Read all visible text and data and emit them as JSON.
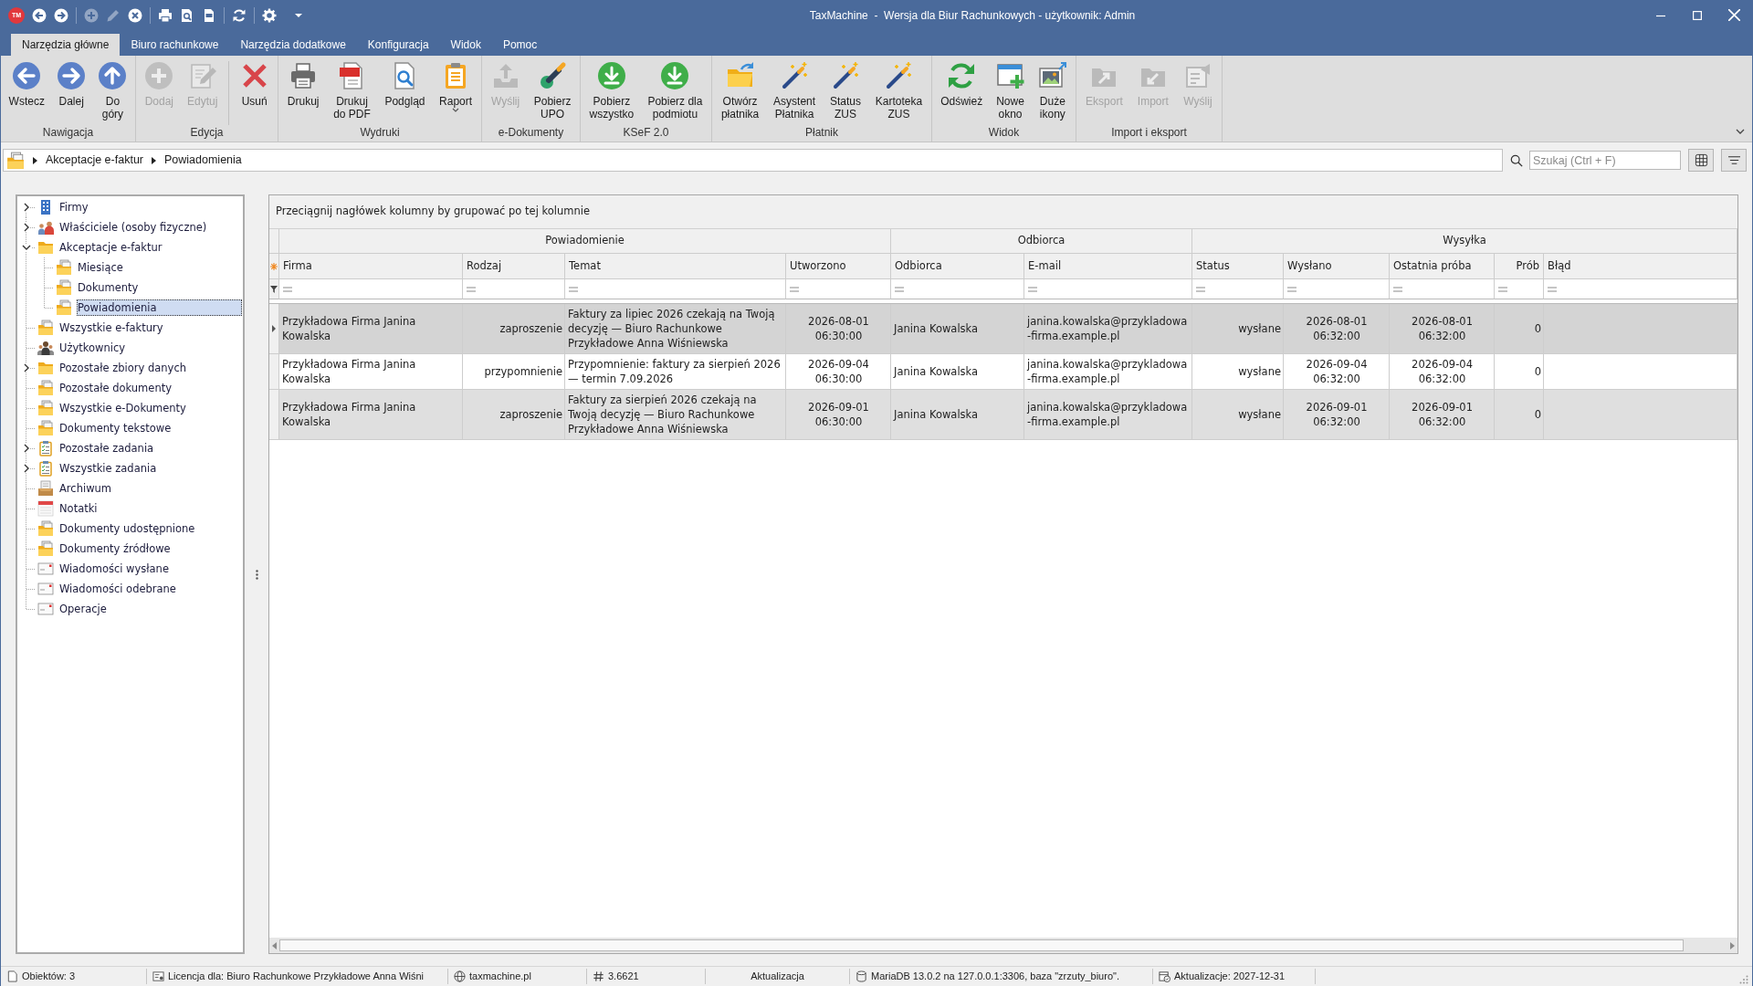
{
  "window": {
    "logo": "TM",
    "title": "TaxMachine  -  Wersja dla Biur Rachunkowych - użytkownik: Admin"
  },
  "quick_access": [
    {
      "kind": "back",
      "disabled": false
    },
    {
      "kind": "forward",
      "disabled": false
    },
    {
      "kind": "separator"
    },
    {
      "kind": "add",
      "disabled": true
    },
    {
      "kind": "edit",
      "disabled": true
    },
    {
      "kind": "delete",
      "disabled": false
    },
    {
      "kind": "separator"
    },
    {
      "kind": "print",
      "disabled": false
    },
    {
      "kind": "preview",
      "disabled": false
    },
    {
      "kind": "pdf",
      "disabled": false
    },
    {
      "kind": "separator"
    },
    {
      "kind": "refresh",
      "disabled": false
    },
    {
      "kind": "separator"
    },
    {
      "kind": "settings",
      "disabled": false
    },
    {
      "kind": "customize"
    }
  ],
  "ribbon": {
    "tabs": [
      {
        "label": "Narzędzia główne",
        "selected": true
      },
      {
        "label": "Biuro rachunkowe",
        "selected": false
      },
      {
        "label": "Narzędzia dodatkowe",
        "selected": false
      },
      {
        "label": "Konfiguracja",
        "selected": false
      },
      {
        "label": "Widok",
        "selected": false
      },
      {
        "label": "Pomoc",
        "selected": false
      }
    ],
    "groups": [
      {
        "label": "Nawigacja",
        "buttons": [
          {
            "label": "Wstecz",
            "kind": "back",
            "disabled": false
          },
          {
            "label": "Dalej",
            "kind": "forward",
            "disabled": false
          },
          {
            "label": "Do\ngóry",
            "kind": "up",
            "disabled": false
          }
        ]
      },
      {
        "label": "Edycja",
        "buttons": [
          {
            "label": "Dodaj",
            "kind": "add",
            "disabled": true
          },
          {
            "label": "Edytuj",
            "kind": "edit",
            "disabled": true
          },
          {
            "label": "Usuń",
            "kind": "delete",
            "disabled": false,
            "separator_before": true
          }
        ]
      },
      {
        "label": "Wydruki",
        "buttons": [
          {
            "label": "Drukuj",
            "kind": "print",
            "disabled": false
          },
          {
            "label": "Drukuj\ndo PDF",
            "kind": "pdf",
            "disabled": false
          },
          {
            "label": "Podgląd",
            "kind": "preview",
            "disabled": false
          },
          {
            "label": "Raport",
            "kind": "report",
            "disabled": false,
            "dropdown": true
          }
        ]
      },
      {
        "label": "e-Dokumenty",
        "buttons": [
          {
            "label": "Wyślij",
            "kind": "send",
            "disabled": true
          },
          {
            "label": "Pobierz\nUPO",
            "kind": "upo",
            "disabled": false
          }
        ]
      },
      {
        "label": "KSeF 2.0",
        "buttons": [
          {
            "label": "Pobierz\nwszystko",
            "kind": "download",
            "disabled": false
          },
          {
            "label": "Pobierz dla\npodmiotu",
            "kind": "download",
            "disabled": false
          }
        ]
      },
      {
        "label": "Płatnik",
        "buttons": [
          {
            "label": "Otwórz\npłatnika",
            "kind": "open-folder",
            "disabled": false
          },
          {
            "label": "Asystent\nPłatnika",
            "kind": "wand",
            "disabled": false
          },
          {
            "label": "Status\nZUS",
            "kind": "wand",
            "disabled": false
          },
          {
            "label": "Kartoteka\nZUS",
            "kind": "wand",
            "disabled": false
          }
        ]
      },
      {
        "label": "Widok",
        "buttons": [
          {
            "label": "Odśwież",
            "kind": "refresh",
            "disabled": false
          },
          {
            "label": "Nowe\nokno",
            "kind": "new-window",
            "disabled": false
          },
          {
            "label": "Duże\nikony",
            "kind": "large-icons",
            "disabled": false
          }
        ]
      },
      {
        "label": "Import i eksport",
        "buttons": [
          {
            "label": "Eksport",
            "kind": "export",
            "disabled": true
          },
          {
            "label": "Import",
            "kind": "import",
            "disabled": true
          },
          {
            "label": "Wyślij",
            "kind": "send-file",
            "disabled": true
          }
        ]
      }
    ]
  },
  "breadcrumb": [
    "Akceptacje e-faktur",
    "Powiadomienia"
  ],
  "search": {
    "placeholder": "Szukaj (Ctrl + F)"
  },
  "sidebar": {
    "items": [
      {
        "label": "Firmy",
        "kind": "building",
        "expanded": false,
        "selected": false
      },
      {
        "label": "Właściciele (osoby fizyczne)",
        "kind": "owners",
        "expanded": false,
        "selected": false
      },
      {
        "label": "Akceptacje e-faktur",
        "kind": "folder",
        "expanded": true,
        "selected": false,
        "children": [
          {
            "label": "Miesiące",
            "kind": "folder-stack",
            "selected": false
          },
          {
            "label": "Dokumenty",
            "kind": "folder-stack",
            "selected": false
          },
          {
            "label": "Powiadomienia",
            "kind": "folder-stack",
            "selected": true
          }
        ]
      },
      {
        "label": "Wszystkie e-faktury",
        "kind": "folder-stack",
        "selected": false
      },
      {
        "label": "Użytkownicy",
        "kind": "users",
        "selected": false
      },
      {
        "label": "Pozostałe zbiory danych",
        "kind": "folder",
        "expanded": false,
        "selected": false
      },
      {
        "label": "Pozostałe dokumenty",
        "kind": "folder-stack",
        "selected": false
      },
      {
        "label": "Wszystkie e-Dokumenty",
        "kind": "folder-stack",
        "selected": false
      },
      {
        "label": "Dokumenty tekstowe",
        "kind": "folder-stack",
        "selected": false
      },
      {
        "label": "Pozostałe zadania",
        "kind": "tasks",
        "expanded": false,
        "selected": false
      },
      {
        "label": "Wszystkie zadania",
        "kind": "tasks",
        "expanded": false,
        "selected": false
      },
      {
        "label": "Archiwum",
        "kind": "archive",
        "selected": false
      },
      {
        "label": "Notatki",
        "kind": "notes",
        "selected": false
      },
      {
        "label": "Dokumenty udostępnione",
        "kind": "folder-stack",
        "selected": false
      },
      {
        "label": "Dokumenty źródłowe",
        "kind": "folder-stack",
        "selected": false
      },
      {
        "label": "Wiadomości wysłane",
        "kind": "message",
        "selected": false
      },
      {
        "label": "Wiadomości odebrane",
        "kind": "message",
        "selected": false
      },
      {
        "label": "Operacje",
        "kind": "message",
        "selected": false
      }
    ]
  },
  "grid": {
    "group_panel_hint": "Przeciągnij nagłówek kolumny by grupować po tej kolumnie",
    "bands": [
      {
        "label": "Powiadomienie",
        "columns": [
          {
            "label": "Firma",
            "kind": "text"
          },
          {
            "label": "Rodzaj",
            "kind": "enum"
          },
          {
            "label": "Temat",
            "kind": "text"
          },
          {
            "label": "Utworzono",
            "kind": "datetime"
          }
        ]
      },
      {
        "label": "Odbiorca",
        "columns": [
          {
            "label": "Odbiorca",
            "kind": "text"
          },
          {
            "label": "E-mail",
            "kind": "email"
          }
        ]
      },
      {
        "label": "Wysyłka",
        "columns": [
          {
            "label": "Status",
            "kind": "enum"
          },
          {
            "label": "Wysłano",
            "kind": "datetime"
          },
          {
            "label": "Ostatnia próba",
            "kind": "datetime"
          },
          {
            "label": "Prób",
            "kind": "count"
          },
          {
            "label": "Błąd",
            "kind": "text"
          }
        ]
      }
    ],
    "rows": [
      {
        "selected": true,
        "cells": [
          "Przykładowa Firma Janina Kowalska",
          "zaproszenie",
          "Faktury za lipiec 2026 czekają na Twoją decyzję — Biuro Rachunkowe Przykładowe Anna Wiśniewska",
          "2026-08-01 06:30:00",
          "Janina Kowalska",
          "janina.kowalska@przykladowa-firma.example.pl",
          "wysłane",
          "2026-08-01 06:32:00",
          "2026-08-01 06:32:00",
          "0"
        ]
      },
      {
        "selected": false,
        "cells": [
          "Przykładowa Firma Janina Kowalska",
          "przypomnienie",
          "Przypomnienie: faktury za sierpień 2026 — termin 7.09.2026",
          "2026-09-04 06:30:00",
          "Janina Kowalska",
          "janina.kowalska@przykladowa-firma.example.pl",
          "wysłane",
          "2026-09-04 06:32:00",
          "2026-09-04 06:32:00",
          "0"
        ]
      },
      {
        "selected": false,
        "cells": [
          "Przykładowa Firma Janina Kowalska",
          "zaproszenie",
          "Faktury za sierpień 2026 czekają na Twoją decyzję — Biuro Rachunkowe Przykładowe Anna Wiśniewska",
          "2026-09-01 06:30:00",
          "Janina Kowalska",
          "janina.kowalska@przykladowa-firma.example.pl",
          "wysłane",
          "2026-09-01 06:32:00",
          "2026-09-01 06:32:00",
          "0"
        ]
      }
    ]
  },
  "status_bar": [
    {
      "kind": "count",
      "text": "Obiektów: 3"
    },
    {
      "kind": "license",
      "text": "Licencja dla: Biuro Rachunkowe Przykładowe Anna Wiśni"
    },
    {
      "kind": "website",
      "text": "taxmachine.pl"
    },
    {
      "kind": "version",
      "text": "3.6621"
    },
    {
      "kind": "update",
      "text": "Aktualizacja"
    },
    {
      "kind": "database",
      "text": "MariaDB 13.0.2 na 127.0.0.1:3306, baza \"zrzuty_biuro\"."
    },
    {
      "kind": "expiry",
      "text": "Aktualizacje: 2027-12-31"
    }
  ]
}
